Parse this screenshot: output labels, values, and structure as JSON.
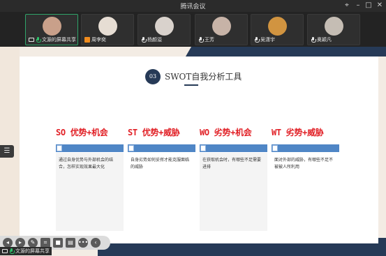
{
  "window": {
    "title": "腾讯会议"
  },
  "participants": [
    {
      "name": "文源的屏幕共享",
      "avatar_color": "#c9a08a",
      "active": true,
      "icon": "screen-share-icon"
    },
    {
      "name": "周李奕",
      "avatar_color": "#e6ddd3",
      "active": false,
      "icon": "orange-user-icon"
    },
    {
      "name": "杨颜溢",
      "avatar_color": "#d9d2cc",
      "active": false,
      "icon": "mic-icon"
    },
    {
      "name": "王芳",
      "avatar_color": "#c7b3a7",
      "active": false,
      "icon": "mic-icon"
    },
    {
      "name": "吴潇宇",
      "avatar_color": "#d19440",
      "active": false,
      "icon": "mic-icon"
    },
    {
      "name": "奥颖凡",
      "avatar_color": "#c5bdb4",
      "active": false,
      "icon": "mic-icon"
    }
  ],
  "slide": {
    "badge": "03",
    "title": "SWOT自我分析工具",
    "columns": [
      {
        "head": "SO 优势+机会",
        "body": "通过自身优势与外部机会的结合，怎样实现效果最大化"
      },
      {
        "head": "ST 优势+威胁",
        "body": "自身劣势如何妥挥才能克服面临的威胁"
      },
      {
        "head": "WO 劣势+机会",
        "body": "在获取机会时，有哪些不足需要进排"
      },
      {
        "head": "WT 劣势+威胁",
        "body": "面对外部的威胁，有哪些不足不被被人所利用"
      }
    ]
  },
  "share_label": "文源的屏幕共享",
  "colors": {
    "accent_navy": "#263a57",
    "head_red": "#e11f25",
    "bar_blue": "#4f86c6",
    "active_green": "#2fa46a"
  }
}
